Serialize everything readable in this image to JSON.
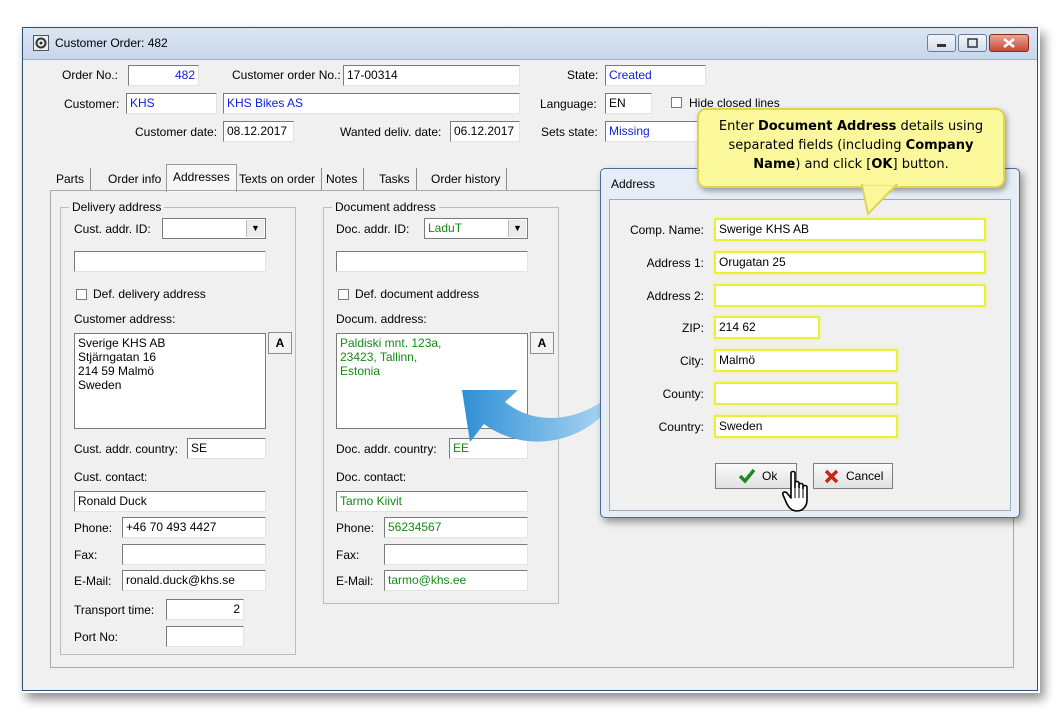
{
  "window": {
    "title": "Customer Order: 482"
  },
  "header": {
    "order_no_label": "Order No.:",
    "order_no": "482",
    "cust_order_no_label": "Customer order No.:",
    "cust_order_no": "17-00314",
    "state_label": "State:",
    "state": "Created",
    "customer_label": "Customer:",
    "customer_code": "KHS",
    "customer_name": "KHS Bikes AS",
    "language_label": "Language:",
    "language": "EN",
    "hide_closed_label": "Hide closed lines",
    "customer_date_label": "Customer date:",
    "customer_date": "08.12.2017",
    "wanted_date_label": "Wanted deliv. date:",
    "wanted_date": "06.12.2017",
    "sets_state_label": "Sets state:",
    "sets_state": "Missing"
  },
  "tabs": [
    "Parts",
    "Order info",
    "Addresses",
    "Texts on order",
    "Notes",
    "Tasks",
    "Order history"
  ],
  "delivery": {
    "group_title": "Delivery address",
    "addr_id_label": "Cust. addr. ID:",
    "addr_id": "",
    "extra_field": "",
    "default_label": "Def. delivery address",
    "address_label": "Customer address:",
    "address": "Sverige KHS AB\nStjärngatan 16\n214 59 Malmö\nSweden",
    "country_label": "Cust. addr. country:",
    "country": "SE",
    "contact_label": "Cust. contact:",
    "contact": "Ronald Duck",
    "phone_label": "Phone:",
    "phone": "+46 70 493 4427",
    "fax_label": "Fax:",
    "fax": "",
    "email_label": "E-Mail:",
    "email": "ronald.duck@khs.se",
    "transport_label": "Transport time:",
    "transport": "2",
    "port_label": "Port No:",
    "port": ""
  },
  "document": {
    "group_title": "Document address",
    "addr_id_label": "Doc. addr. ID:",
    "addr_id": "LaduT",
    "extra_field": "",
    "default_label": "Def. document address",
    "address_label": "Docum. address:",
    "address": "Paldiski mnt. 123a,\n23423, Tallinn,\nEstonia",
    "country_label": "Doc. addr. country:",
    "country": "EE",
    "contact_label": "Doc. contact:",
    "contact": "Tarmo Kiivit",
    "phone_label": "Phone:",
    "phone": "56234567",
    "fax_label": "Fax:",
    "fax": "",
    "email_label": "E-Mail:",
    "email": "tarmo@khs.ee"
  },
  "a_button": "A",
  "dialog": {
    "title": "Address",
    "comp_name_label": "Comp. Name:",
    "comp_name": "Swerige KHS AB",
    "address1_label": "Address 1:",
    "address1": "Orugatan 25",
    "address2_label": "Address 2:",
    "address2": "",
    "zip_label": "ZIP:",
    "zip": "214 62",
    "city_label": "City:",
    "city": "Malmö",
    "county_label": "County:",
    "county": "",
    "country_label": "Country:",
    "country": "Sweden",
    "ok_label": "Ok",
    "cancel_label": "Cancel"
  },
  "callout": {
    "part1": "Enter ",
    "bold1": "Document Address",
    "part2": " details using separated fields (including ",
    "bold2": "Company Name",
    "part3": ") and click [",
    "bold3": "OK",
    "part4": "] button."
  },
  "colors": {
    "accent_blue": "#1020e0",
    "accent_green": "#138a14",
    "highlight": "#e8ef3c",
    "arrow": "#3a9bd8",
    "callout_bg": "#fbf89c"
  }
}
